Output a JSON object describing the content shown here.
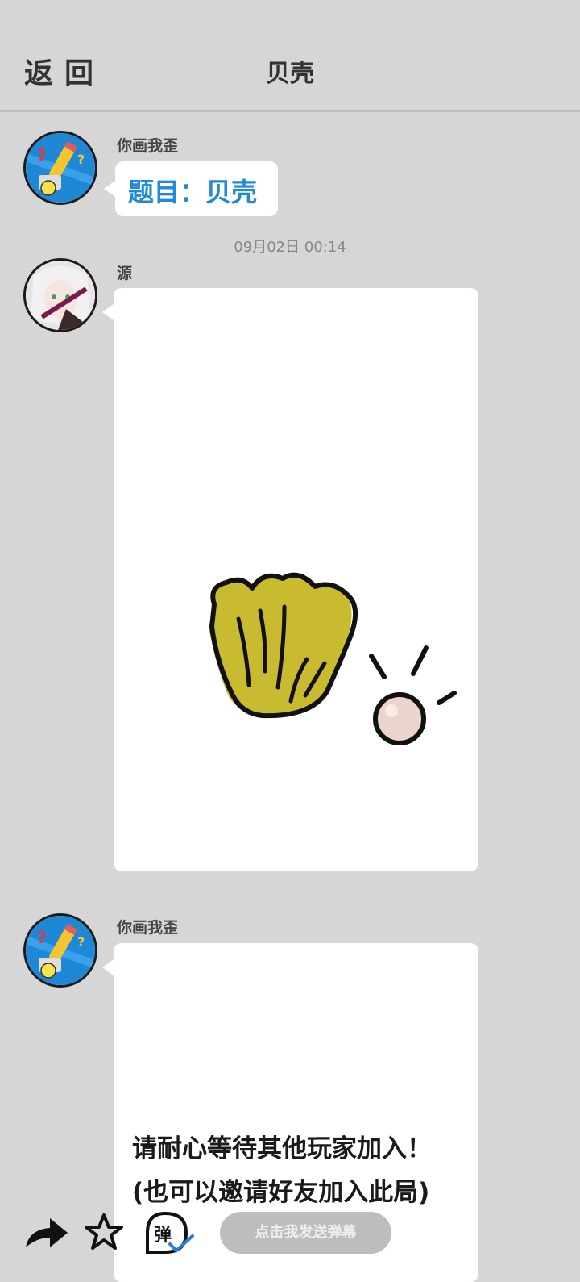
{
  "header": {
    "back_label": "返回",
    "title": "贝壳"
  },
  "messages": [
    {
      "username": "你画我歪",
      "topic": "题目：贝壳"
    },
    {
      "timestamp": "09月02日 00:14",
      "username": "源"
    },
    {
      "username": "你画我歪",
      "wait_line1": "请耐心等待其他玩家加入！",
      "wait_line2": "(也可以邀请好友加入此局)"
    }
  ],
  "bottom_bar": {
    "danmu_placeholder": "点击我发送弹幕",
    "danmu_badge": "弹"
  },
  "icons": [
    "back",
    "share-arrow-icon",
    "star-icon",
    "danmu-icon",
    "pencil-icon",
    "shell-drawing"
  ],
  "colors": {
    "background": "#d6d6d6",
    "topic": "#1e8ad8",
    "shell": "#c9bb2f",
    "pearl": "#ead4cc"
  }
}
